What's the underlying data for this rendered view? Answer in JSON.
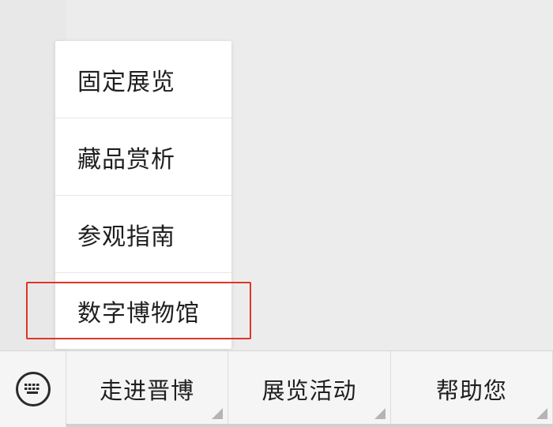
{
  "submenu": {
    "items": [
      {
        "label": "固定展览"
      },
      {
        "label": "藏品赏析"
      },
      {
        "label": "参观指南"
      },
      {
        "label": "数字博物馆"
      }
    ]
  },
  "bottom_menu": {
    "keyboard_icon": "keyboard-icon",
    "tabs": [
      {
        "label": "走进晋博"
      },
      {
        "label": "展览活动"
      },
      {
        "label": "帮助您"
      }
    ]
  },
  "colors": {
    "highlight": "#e0342a",
    "background": "#ececec",
    "menu_bg": "#ffffff",
    "bar_bg": "#f5f5f5"
  }
}
